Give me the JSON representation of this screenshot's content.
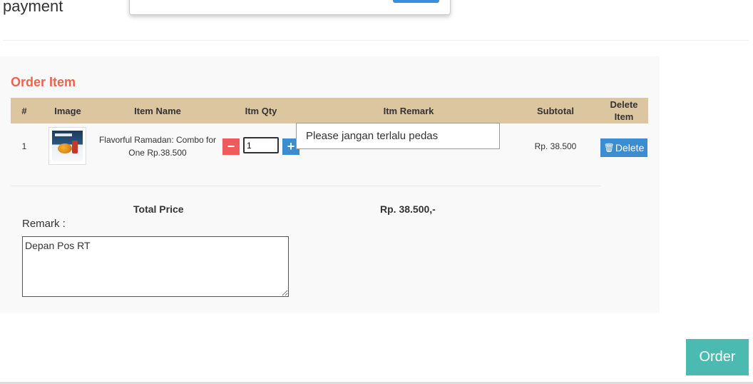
{
  "page": {
    "title": "payment"
  },
  "order_section": {
    "heading": "Order Item",
    "columns": {
      "num": "#",
      "image": "Image",
      "item_name": "Item Name",
      "qty": "Itm Qty",
      "remark": "Itm Remark",
      "subtotal": "Subtotal",
      "delete": "Delete Item"
    },
    "items": [
      {
        "num": "1",
        "image_icon": "food-thumbnail",
        "item_name": "Flavorful Ramadan: Combo for One Rp.38.500",
        "qty": "1",
        "qty_minus": "−",
        "qty_plus": "+",
        "remark": "Please jangan terlalu pedas",
        "subtotal": "Rp. 38.500",
        "delete_label": "Delete",
        "delete_icon": "trash-icon"
      }
    ],
    "total_label": "Total Price",
    "total_value": "Rp. 38.500,-",
    "remark_label": "Remark :",
    "remark_value": "Depan Pos RT"
  },
  "actions": {
    "order_label": "Order"
  },
  "colors": {
    "heading": "#f0624d",
    "header_bg": "#dcc6a0",
    "minus": "#f05a5a",
    "plus": "#3c8dcf",
    "delete": "#3c8dcf",
    "order": "#4bbab0"
  }
}
